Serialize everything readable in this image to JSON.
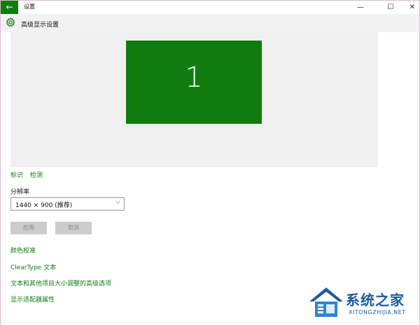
{
  "window": {
    "title": "设置"
  },
  "titlebar": {
    "back_icon": "←",
    "min_icon": "—",
    "max_icon": "☐",
    "close_icon": "✕"
  },
  "header": {
    "title": "高级显示设置"
  },
  "preview": {
    "monitor_label": "1"
  },
  "links": {
    "identify": "标识",
    "detect": "检测"
  },
  "resolution": {
    "label": "分辨率",
    "value": "1440 × 900 (推荐)",
    "chevron": "⌵"
  },
  "buttons": {
    "apply": "应用",
    "cancel": "取消"
  },
  "settings_links": {
    "calibration": "颜色校准",
    "cleartype": "ClearType 文本",
    "advanced_sizing": "文本和其他项目大小调整的高级选项",
    "adapter_properties": "显示适配器属性"
  },
  "watermark": {
    "text": "系统之家",
    "url": "XITONGZHIJIA.NET"
  },
  "colors": {
    "accent": "#107c10",
    "watermark": "#1c5c9c"
  }
}
